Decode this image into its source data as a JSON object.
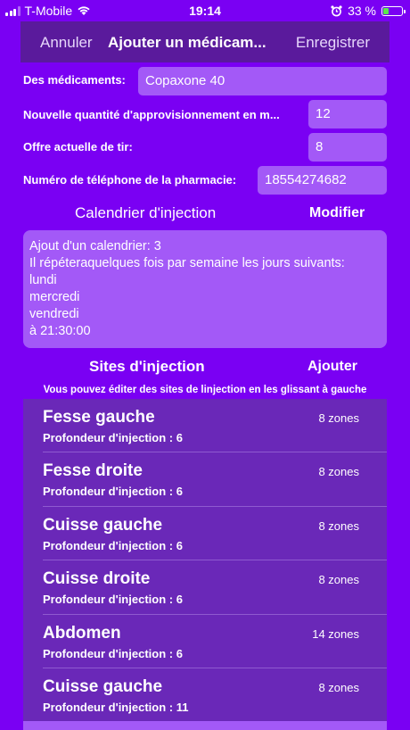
{
  "status": {
    "carrier": "T-Mobile",
    "time": "19:14",
    "battery": "33 %",
    "battery_level": 0.33
  },
  "nav": {
    "cancel_label": "Annuler",
    "title": "Ajouter un médicam...",
    "save_label": "Enregistrer"
  },
  "form": {
    "medication_label": "Des médicaments:",
    "medication_value": "Copaxone 40",
    "supply_label": "Nouvelle quantité d'approvisionnement en m...",
    "supply_value": "12",
    "current_label": "Offre actuelle de tir:",
    "current_value": "8",
    "pharmacy_label": "Numéro de téléphone de la pharmacie:",
    "pharmacy_value": "18554274682"
  },
  "calendar": {
    "header": "Calendrier d'injection",
    "edit_label": "Modifier",
    "lines": [
      "Ajout d'un calendrier: 3",
      "Il répéteraquelques fois par semaine les jours suivants:",
      "lundi",
      "mercredi",
      "vendredi",
      "à 21:30:00"
    ]
  },
  "sites": {
    "header": "Sites d'injection",
    "add_label": "Ajouter",
    "hint": "Vous pouvez éditer des sites de linjection en les glissant à gauche",
    "items": [
      {
        "name": "Fesse gauche",
        "depth": "Profondeur d'injection : 6",
        "zones": "8 zones"
      },
      {
        "name": "Fesse droite",
        "depth": "Profondeur d'injection : 6",
        "zones": "8 zones"
      },
      {
        "name": "Cuisse gauche",
        "depth": "Profondeur d'injection : 6",
        "zones": "8 zones"
      },
      {
        "name": "Cuisse droite",
        "depth": "Profondeur d'injection : 6",
        "zones": "8 zones"
      },
      {
        "name": "Abdomen",
        "depth": "Profondeur d'injection : 6",
        "zones": "14 zones"
      },
      {
        "name": "Cuisse gauche",
        "depth": "Profondeur d'injection : 11",
        "zones": "8 zones"
      }
    ]
  },
  "colors": {
    "background": "#7a00f3",
    "navbar": "#5a1a9c",
    "field": "#a359f7",
    "list": "#6a28b8"
  }
}
